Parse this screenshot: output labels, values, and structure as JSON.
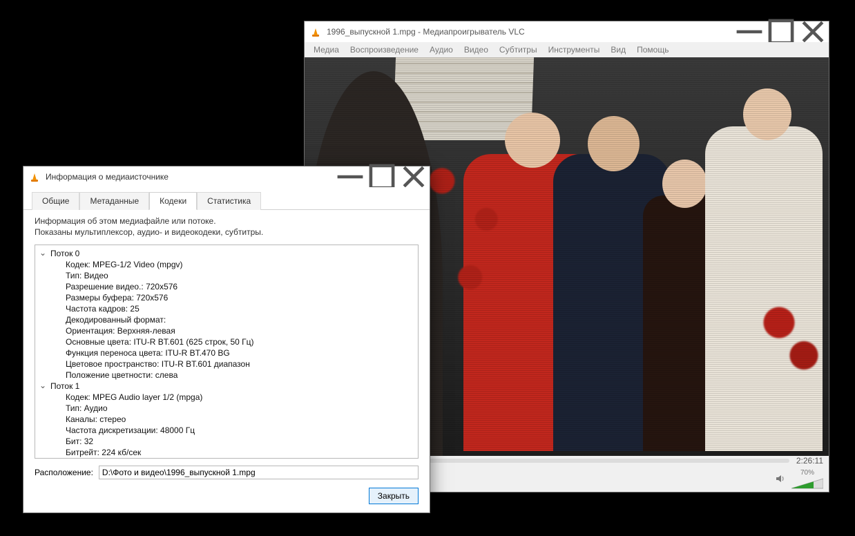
{
  "player": {
    "title": "1996_выпускной 1.mpg - Медиапроигрыватель VLC",
    "menus": [
      "Медиа",
      "Воспроизведение",
      "Аудио",
      "Видео",
      "Субтитры",
      "Инструменты",
      "Вид",
      "Помощь"
    ],
    "time_total": "2:26:11",
    "volume_percent": "70%",
    "controls": {
      "playlist": "playlist-icon",
      "loop": "loop-icon",
      "shuffle": "shuffle-icon",
      "speaker": "speaker-icon"
    }
  },
  "dialog": {
    "title": "Информация о медиаисточнике",
    "tabs": [
      "Общие",
      "Метаданные",
      "Кодеки",
      "Статистика"
    ],
    "active_tab_index": 2,
    "desc_line1": "Информация об этом медиафайле или потоке.",
    "desc_line2": "Показаны мультиплексор, аудио- и видеокодеки, субтитры.",
    "streams": [
      {
        "name": "Поток 0",
        "rows": [
          "Кодек: MPEG-1/2 Video (mpgv)",
          "Тип: Видео",
          "Разрешение видео.: 720x576",
          "Размеры буфера: 720x576",
          "Частота кадров: 25",
          "Декодированный формат:",
          "Ориентация: Верхняя-левая",
          "Основные цвета: ITU-R BT.601 (625 строк, 50 Гц)",
          "Функция переноса цвета: ITU-R BT.470 BG",
          "Цветовое пространство: ITU-R BT.601 диапазон",
          "Положение цветности: слева"
        ]
      },
      {
        "name": "Поток 1",
        "rows": [
          "Кодек: MPEG Audio layer 1/2 (mpga)",
          "Тип: Аудио",
          "Каналы: стерео",
          "Частота дискретизации: 48000 Гц",
          "Бит: 32",
          "Битрейт: 224 кб/сек"
        ]
      }
    ],
    "location_label": "Расположение:",
    "location_value": "D:\\Фото и видео\\1996_выпускной 1.mpg",
    "close_button": "Закрыть"
  }
}
